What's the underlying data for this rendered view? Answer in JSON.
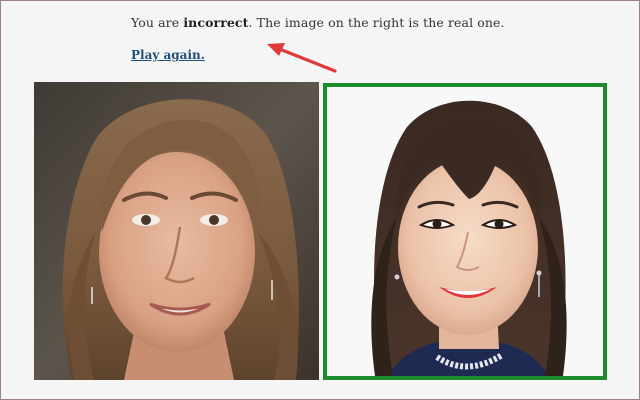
{
  "result": {
    "prefix": "You are ",
    "verdict": "incorrect",
    "suffix": ". The image on the right is the real one."
  },
  "play_again": {
    "label": "Play again."
  },
  "annotation": {
    "arrow_color": "#e03a3a"
  },
  "images": {
    "left": {
      "role": "generated-face",
      "selected_as_real": false
    },
    "right": {
      "role": "real-face",
      "highlight_color": "#1e8c2a"
    }
  }
}
